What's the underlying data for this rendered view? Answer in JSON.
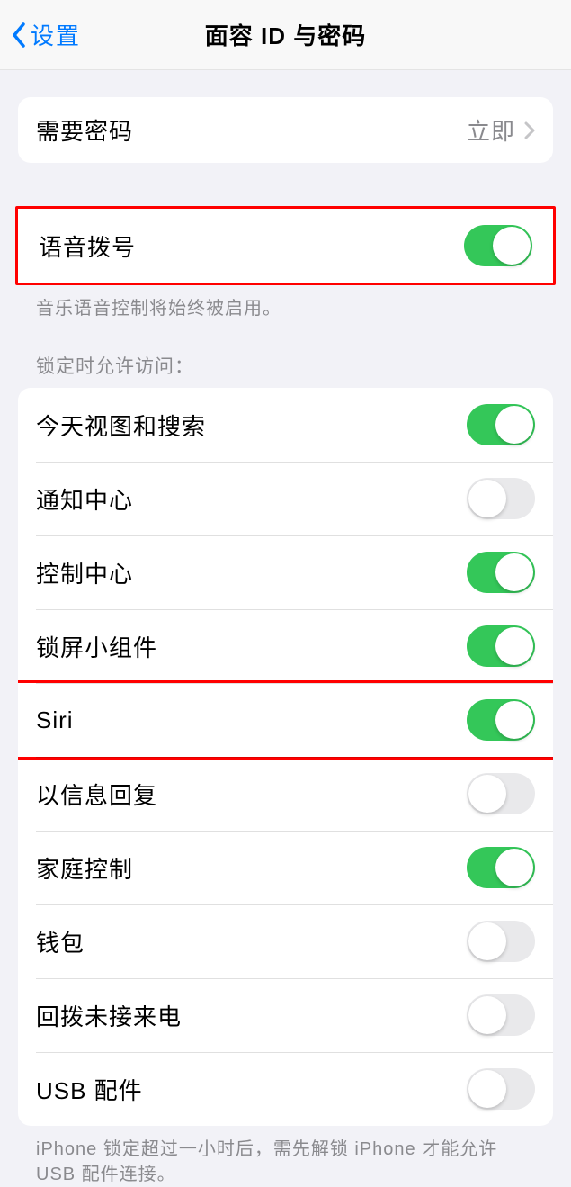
{
  "nav": {
    "back_label": "设置",
    "title": "面容 ID 与密码"
  },
  "require_passcode": {
    "label": "需要密码",
    "value": "立即"
  },
  "voice_dial": {
    "label": "语音拨号",
    "on": true,
    "footer": "音乐语音控制将始终被启用。"
  },
  "lock_access": {
    "header": "锁定时允许访问：",
    "items": [
      {
        "label": "今天视图和搜索",
        "on": true,
        "highlight": false
      },
      {
        "label": "通知中心",
        "on": false,
        "highlight": false
      },
      {
        "label": "控制中心",
        "on": true,
        "highlight": false
      },
      {
        "label": "锁屏小组件",
        "on": true,
        "highlight": false
      },
      {
        "label": "Siri",
        "on": true,
        "highlight": true
      },
      {
        "label": "以信息回复",
        "on": false,
        "highlight": false
      },
      {
        "label": "家庭控制",
        "on": true,
        "highlight": false
      },
      {
        "label": "钱包",
        "on": false,
        "highlight": false
      },
      {
        "label": "回拨未接来电",
        "on": false,
        "highlight": false
      },
      {
        "label": "USB 配件",
        "on": false,
        "highlight": false
      }
    ],
    "footer": "iPhone 锁定超过一小时后，需先解锁 iPhone 才能允许 USB 配件连接。"
  }
}
